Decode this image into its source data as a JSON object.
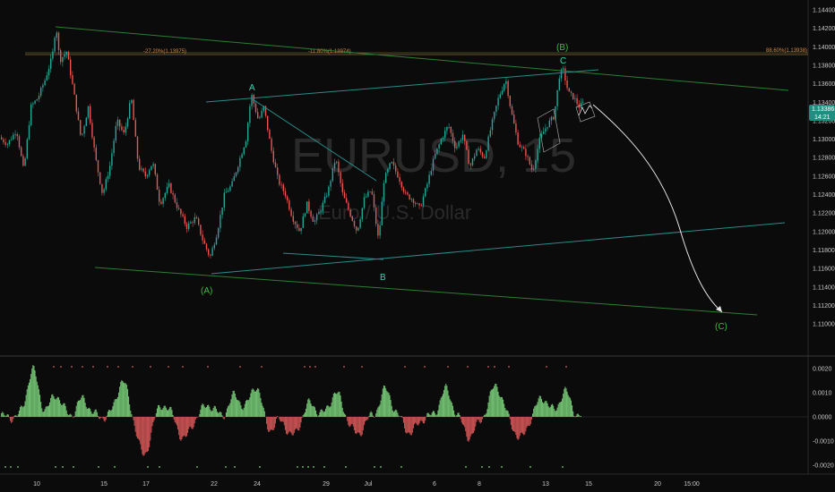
{
  "watermark": {
    "symbol": "EURUSD, 15",
    "description": "Euro / U.S. Dollar"
  },
  "price_badge": {
    "price": "1.13386",
    "countdown": "14:21"
  },
  "fib_labels": [
    "-27.20%(1.13975)",
    "-11.80%(1.13974)",
    "88.60%(1.13938)"
  ],
  "wave_labels": [
    {
      "text": "A",
      "color": "#3fd0b0"
    },
    {
      "text": "B",
      "color": "#3fd0b0"
    },
    {
      "text": "C",
      "color": "#3fd0b0"
    },
    {
      "text": "(A)",
      "color": "#3dbb3d"
    },
    {
      "text": "(B)",
      "color": "#3dbb3d"
    },
    {
      "text": "(C)",
      "color": "#3dbb3d"
    }
  ],
  "colors": {
    "background": "#0b0b0b",
    "up": "#26a69a",
    "down": "#ef5350",
    "osc_up": "#7fd87f",
    "osc_down": "#e05c5c",
    "teal_line": "#2b8a8a",
    "green_line": "#2e7d32",
    "projection": "#e6e6e6",
    "badge": "#1f8f82"
  },
  "chart_data": [
    {
      "type": "candlestick",
      "title": "EURUSD, 15",
      "y_ticks": [
        "1.14400",
        "1.14200",
        "1.14000",
        "1.13800",
        "1.13600",
        "1.13400",
        "1.13200",
        "1.13000",
        "1.12800",
        "1.12600",
        "1.12400",
        "1.12200",
        "1.12000",
        "1.11800",
        "1.11600",
        "1.11400",
        "1.11200",
        "1.11000"
      ],
      "ylim": [
        1.1095,
        1.1445
      ],
      "x_ticks": [
        "10",
        "15",
        "17",
        "22",
        "24",
        "29",
        "Jul",
        "6",
        "8",
        "13",
        "15",
        "20",
        "15:00"
      ],
      "wave_points": [
        {
          "label": "(A)",
          "date": "Jun 22",
          "price": 1.117
        },
        {
          "label": "A",
          "date": "Jun 23",
          "price": 1.1349
        },
        {
          "label": "B",
          "date": "Jun 30",
          "price": 1.1186
        },
        {
          "label": "C",
          "date": "Jul 14",
          "price": 1.1375
        },
        {
          "label": "(B)",
          "date": "Jul 14",
          "price": 1.1375
        },
        {
          "label": "(C)",
          "date": "projection",
          "price": 1.1132
        }
      ],
      "fib_levels": [
        {
          "label": "-27.20%",
          "price": 1.13975
        },
        {
          "label": "-11.80%",
          "price": 1.13974
        },
        {
          "label": "88.60%",
          "price": 1.13938
        }
      ],
      "last_price": 1.13386,
      "grid": false
    },
    {
      "type": "histogram",
      "title": "",
      "y_ticks": [
        "0.0020",
        "0.0010",
        "0.0000",
        "-0.0010",
        "-0.0020"
      ],
      "ylim": [
        -0.0023,
        0.0023
      ]
    }
  ]
}
